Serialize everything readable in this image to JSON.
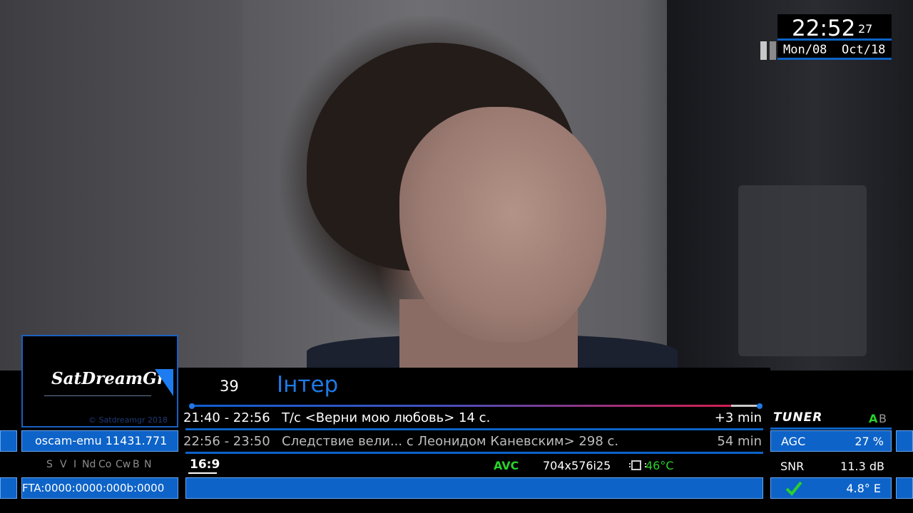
{
  "clock": {
    "time": "22:52",
    "seconds": "27",
    "day": "Mon/08",
    "month": "Oct/18"
  },
  "logo": {
    "name": "SatDreamGr",
    "copyright": "© Satdreamgr 2018"
  },
  "channel": {
    "number": "39",
    "name": "Інтер"
  },
  "progress": {
    "fraction": 0.95
  },
  "events": [
    {
      "time": "21:40 - 22:56",
      "title": "Т/с <Верни мою любовь> 14 с.",
      "remaining": "+3 min"
    },
    {
      "time": "22:56 - 23:50",
      "title": "Следствие вели... с Леонидом Каневским> 298 с.",
      "remaining": "54 min"
    }
  ],
  "tech": {
    "aspect": "16:9",
    "codec": "AVC",
    "resolution": "704x576i25",
    "temperature": "46°C"
  },
  "left": {
    "emulator": "oscam-emu 11431.771",
    "caids": [
      "S",
      "V",
      "I",
      "Nd",
      "Co",
      "Cw",
      "B",
      "N"
    ],
    "fta": "FTA:0000:0000:000b:0000"
  },
  "tuner": {
    "label": "TUNER",
    "a": "A",
    "b": "B",
    "agc_label": "AGC",
    "agc_value": "27 %",
    "snr_label": "SNR",
    "snr_value": "11.3 dB",
    "orbital": "4.8° E"
  },
  "colors": {
    "accent_blue": "#0d63c8",
    "channel_blue": "#1f79e4",
    "ok_green": "#2ad12a"
  },
  "icons": {
    "lock_status": "check-icon",
    "recording": "pause-bars-icon",
    "temperature": "chip-icon"
  }
}
